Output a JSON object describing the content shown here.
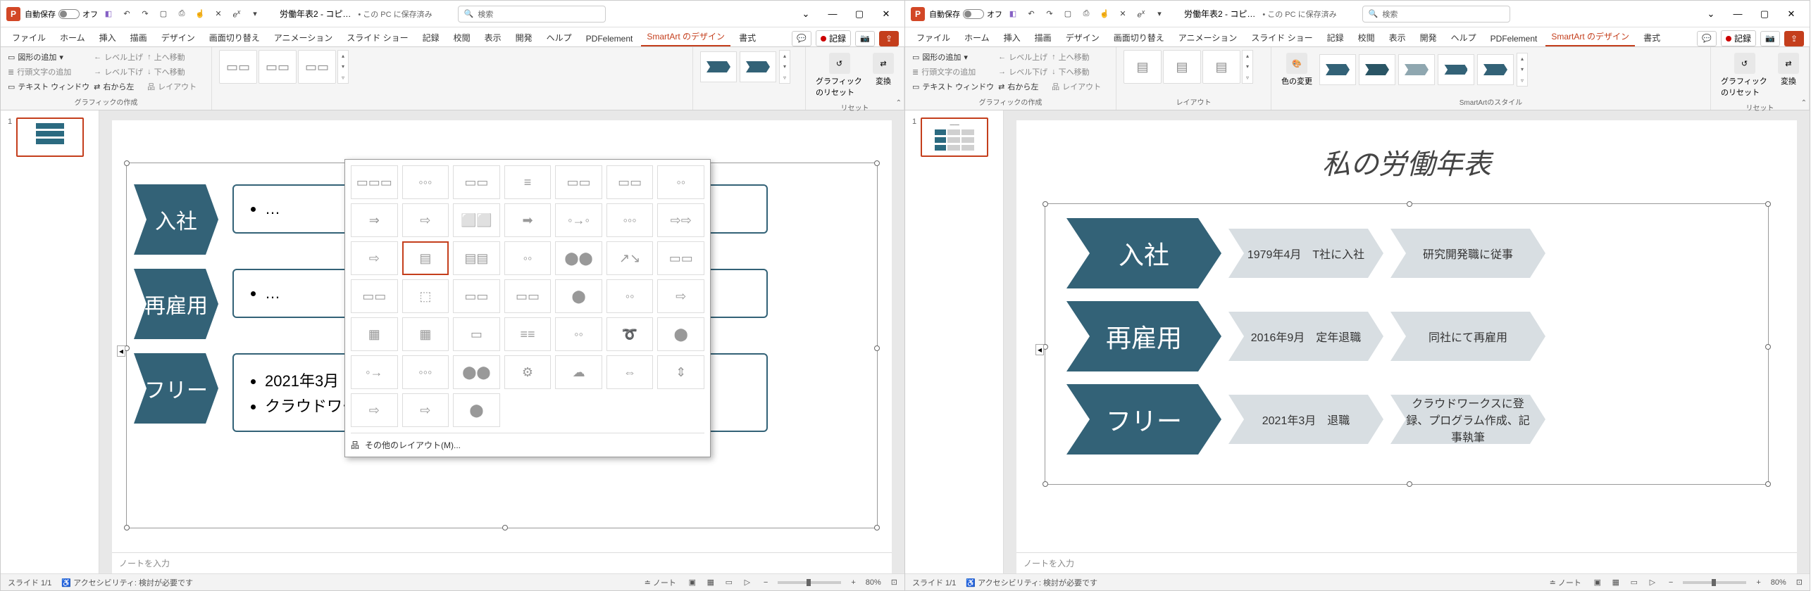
{
  "app": {
    "letter": "P",
    "autosave_label": "自動保存",
    "autosave_state": "オフ"
  },
  "doc": {
    "title": "労働年表2 - コピ…",
    "saved": "• この PC に保存済み",
    "search_placeholder": "検索"
  },
  "tabs": [
    "ファイル",
    "ホーム",
    "挿入",
    "描画",
    "デザイン",
    "画面切り替え",
    "アニメーション",
    "スライド ショー",
    "記録",
    "校閲",
    "表示",
    "開発",
    "ヘルプ",
    "PDFelement"
  ],
  "tab_smartart": "SmartArt のデザイン",
  "tab_format": "書式",
  "record_label": "記録",
  "ribbon": {
    "add_shape": "図形の追加",
    "add_bullet": "行頭文字の追加",
    "text_window": "テキスト ウィンドウ",
    "level_up": "レベル上げ",
    "level_down": "レベル下げ",
    "right_to_left": "右から左",
    "move_up": "上へ移動",
    "move_down": "下へ移動",
    "layout_btn": "レイアウト",
    "group_create": "グラフィックの作成",
    "group_layout": "レイアウト",
    "group_style": "SmartArtのスタイル",
    "group_reset": "リセット",
    "change_colors": "色の変更",
    "reset_graphic": "グラフィックのリセット",
    "convert": "変換",
    "more_layouts": "その他のレイアウト(M)..."
  },
  "slide": {
    "title": "私の労働年表",
    "rows": [
      {
        "head": "入社",
        "c1": "1979年4月　T社に入社",
        "c2": "研究開発職に従事"
      },
      {
        "head": "再雇用",
        "c1": "2016年9月　定年退職",
        "c2": "同社にて再雇用"
      },
      {
        "head": "フリー",
        "c1": "2021年3月　退職",
        "c2": "クラウドワークスに登録、プログラム作成、記事執筆"
      }
    ],
    "free_bullets": [
      "2021年3月　退職",
      "クラウドワークスに登録、プログラム作成、記事執筆"
    ]
  },
  "notes_placeholder": "ノートを入力",
  "status": {
    "slide": "スライド 1/1",
    "a11y": "アクセシビリティ: 検討が必要です",
    "notes_btn": "ノート",
    "zoom": "80%"
  }
}
